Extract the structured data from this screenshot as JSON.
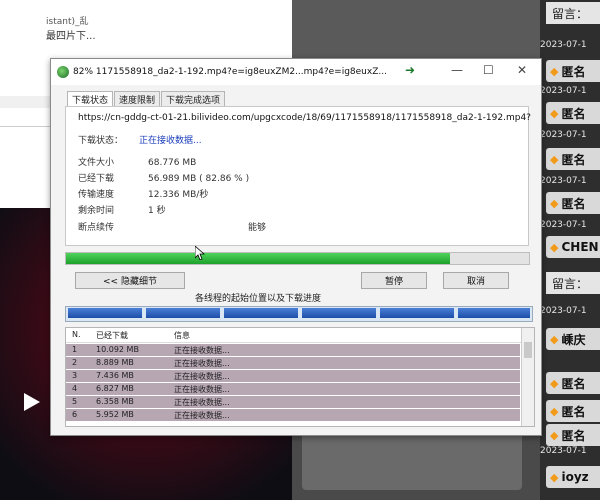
{
  "background": {
    "top_note_1": "istant)_乱",
    "top_note_2": "最四片下..."
  },
  "right_panel": {
    "dates": [
      "2023-07-1",
      "2023-07-1",
      "2023-07-1",
      "2023-07-1",
      "2023-07-1",
      "2023-07-1",
      "2023-07-1"
    ],
    "labels_top": "留言：",
    "labels_mid": "留言：",
    "chips": [
      "匿名",
      "匿名",
      "匿名",
      "匿名",
      "CHEN",
      "嵊庆",
      "匿名",
      "匿名",
      "匿名",
      "ioyz"
    ]
  },
  "window": {
    "title": "82% 1171558918_da2-1-192.mp4?e=ig8euxZM2...mp4?e=ig8euxZ...",
    "tabs": [
      "下载状态",
      "速度限制",
      "下载完成选项"
    ],
    "url": "https://cn-gddg-ct-01-21.bilivideo.com/upgcxcode/18/69/1171558918/1171558918_da2-1-192.mp4?",
    "status_label": "下载状态：",
    "status_value": "正在接收数据...",
    "stats": [
      {
        "key": "文件大小",
        "value": "68.776  MB"
      },
      {
        "key": "已经下载",
        "value": "56.989  MB  ( 82.86 % )"
      },
      {
        "key": "传输速度",
        "value": "12.336  MB/秒"
      },
      {
        "key": "剩余时间",
        "value": "1 秒"
      },
      {
        "key": "断点续传",
        "value": "能够"
      }
    ],
    "progress_percent": 82.86,
    "hide_details_label": "<< 隐藏细节",
    "pause_label": "暂停",
    "cancel_label": "取消",
    "segments_label": "各线程的起始位置以及下载进度",
    "table": {
      "headers": [
        "N.",
        "已经下载",
        "信息"
      ],
      "rows": [
        {
          "n": "1",
          "downloaded": "10.092  MB",
          "info": "正在接收数据..."
        },
        {
          "n": "2",
          "downloaded": "8.889  MB",
          "info": "正在接收数据..."
        },
        {
          "n": "3",
          "downloaded": "7.436  MB",
          "info": "正在接收数据..."
        },
        {
          "n": "4",
          "downloaded": "6.827  MB",
          "info": "正在接收数据..."
        },
        {
          "n": "5",
          "downloaded": "6.358  MB",
          "info": "正在接收数据..."
        },
        {
          "n": "6",
          "downloaded": "5.952  MB",
          "info": "正在接收数据..."
        }
      ]
    }
  },
  "colors": {
    "progress": "#1ca12c",
    "segment": "#1e4fa8",
    "row": "#b7a7b3"
  }
}
